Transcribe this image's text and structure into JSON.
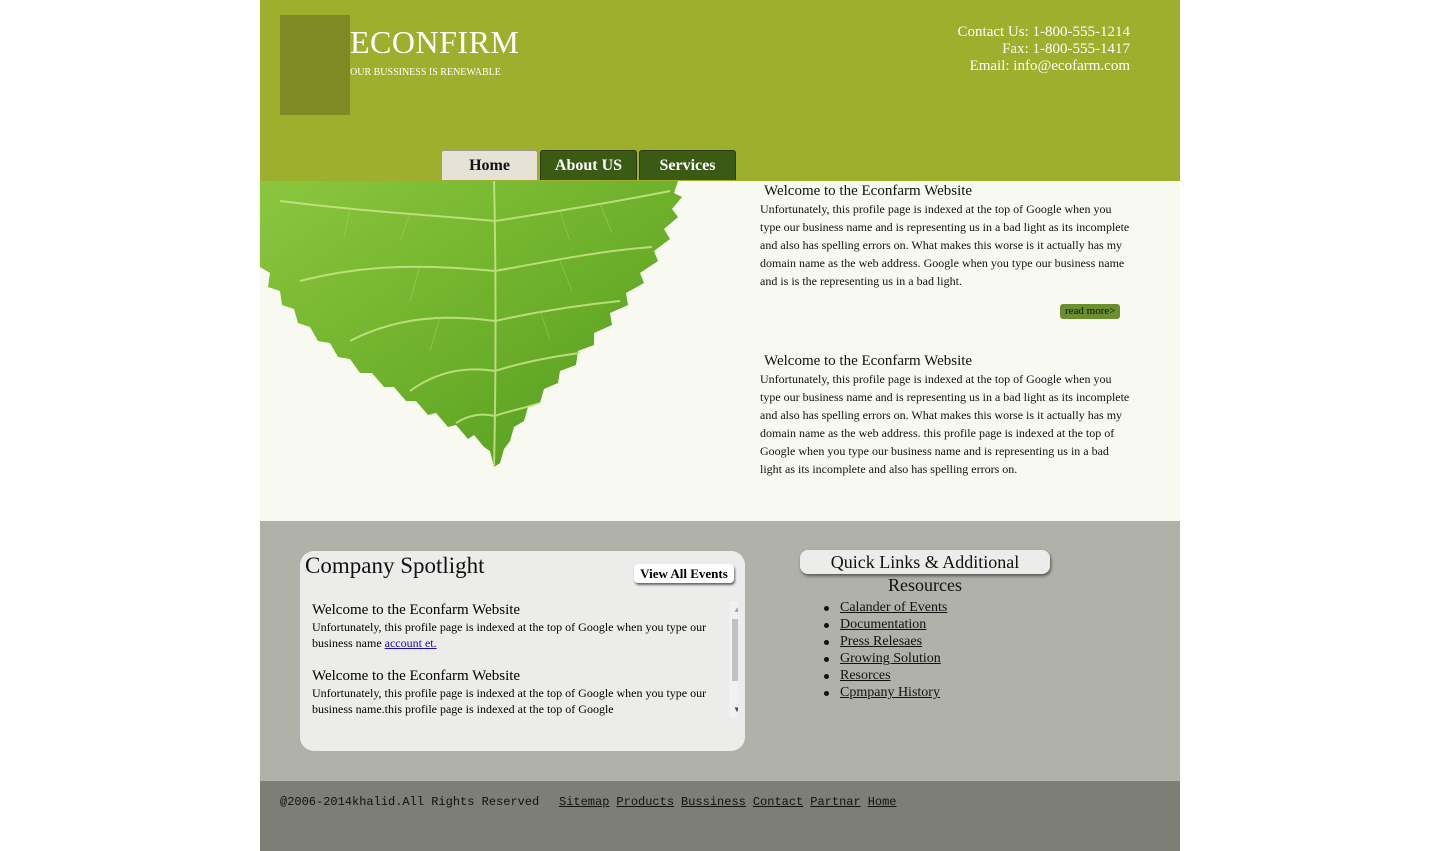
{
  "header": {
    "title": "ECONFIRM",
    "tagline": "OUR BUSSINESS IS RENEWABLE",
    "contact_phone": "Contact Us: 1-800-555-1214",
    "contact_fax": "Fax: 1-800-555-1417",
    "contact_email": "Email: info@ecofarm.com"
  },
  "nav": [
    {
      "label": "Home",
      "active": true
    },
    {
      "label": "About US",
      "active": false
    },
    {
      "label": "Services",
      "active": false
    }
  ],
  "articles": [
    {
      "title": "Welcome to the Econfarm Website",
      "body": "Unfortunately, this profile page is indexed at the top of Google when you type our business name and is representing us in a bad light as its incomplete and also has spelling errors on. What makes this worse is it actually has my domain name as the web address. Google when you type our business name and is is the representing us in a bad light."
    },
    {
      "title": "Welcome to the Econfarm Website",
      "body": "Unfortunately, this profile page is indexed at the top of Google when you type our business name and is representing us in a bad light as its incomplete and also has spelling errors on. What makes this worse is it actually has my domain name as the web address. this profile page is indexed at the top of Google when you type our business name and is representing us in a bad light as its incomplete and also has spelling errors on."
    }
  ],
  "read_more": "read more>",
  "spotlight": {
    "title": "Company Spotlight",
    "view_all": "View All Events",
    "items": [
      {
        "title": "Welcome to the Econfarm Website",
        "body": "Unfortunately, this profile page is indexed at the top of Google when you type our business name ",
        "link": "account et."
      },
      {
        "title": "Welcome to the Econfarm Website",
        "body": "Unfortunately, this profile page is indexed at the top of Google when you type our business name.this profile page is indexed at the top of Google"
      }
    ]
  },
  "quick_links": {
    "title_line1": "Quick Links & Additional",
    "title_line2": "Resources",
    "items": [
      "Calander of Events",
      "Documentation",
      "Press Relesaes",
      "Growing Solution",
      "Resorces",
      "Cpmpany History"
    ]
  },
  "footer": {
    "copyright": "@2006-2014khalid.All Rights Reserved",
    "links": [
      "Sitemap",
      "Products",
      "Bussiness",
      "Contact",
      "Partnar",
      "Home"
    ]
  },
  "colors": {
    "header_bg": "#9eae2d",
    "logo_box": "#7f8a25",
    "nav_inactive": "#3b5a14",
    "nav_active": "#e6e3d6",
    "main_bg": "#f8faf2",
    "middle_bg": "#b0b2aa",
    "footer_bg": "#7d7e76",
    "read_more_bg": "#6b8f2e"
  },
  "icons": {
    "scroll_up": "scroll-up-arrow-icon",
    "scroll_down": "scroll-down-arrow-icon",
    "bullet": "bullet-icon"
  }
}
